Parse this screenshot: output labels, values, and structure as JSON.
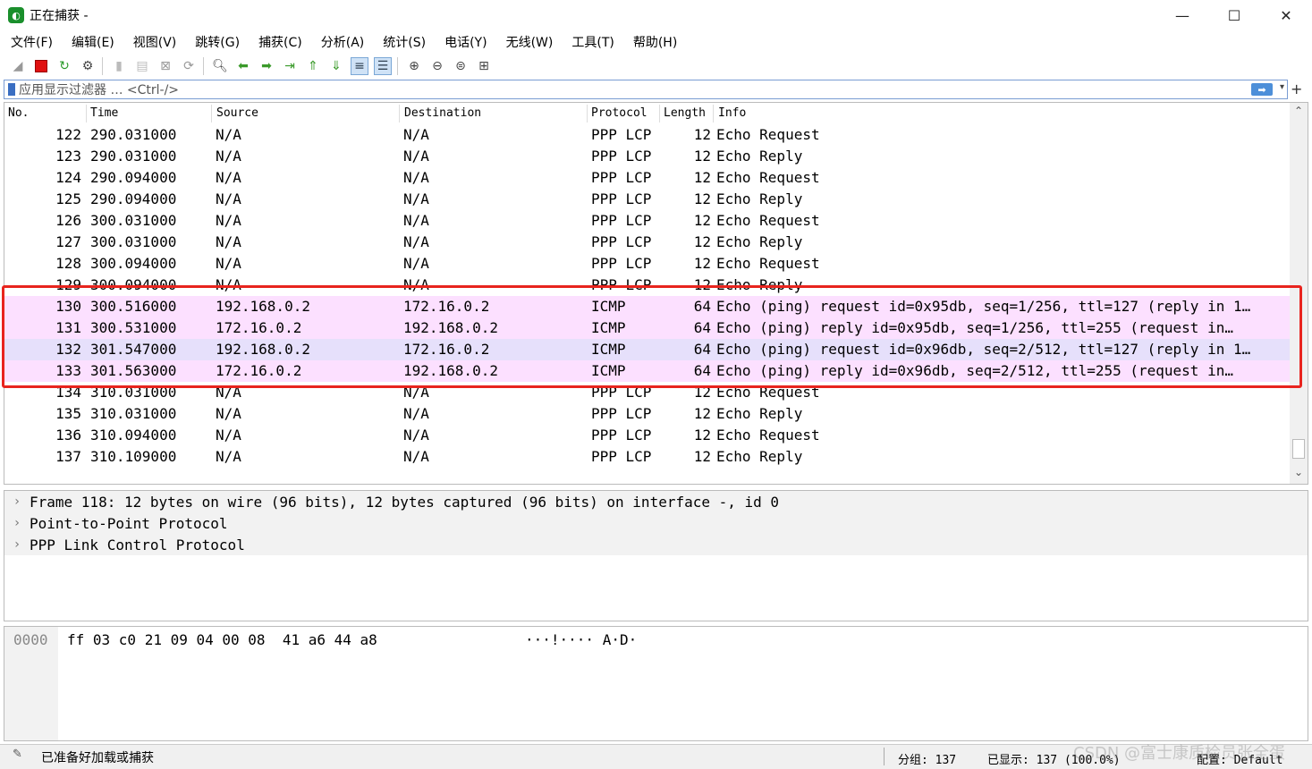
{
  "window": {
    "title": "正在捕获 -",
    "minimize": "—",
    "maximize": "☐",
    "close": "✕"
  },
  "menu": [
    "文件(F)",
    "编辑(E)",
    "视图(V)",
    "跳转(G)",
    "捕获(C)",
    "分析(A)",
    "统计(S)",
    "电话(Y)",
    "无线(W)",
    "工具(T)",
    "帮助(H)"
  ],
  "filter": {
    "placeholder": "应用显示过滤器 … <Ctrl-/>",
    "apply": "➡",
    "add": "+"
  },
  "columns": {
    "no": "No.",
    "time": "Time",
    "source": "Source",
    "destination": "Destination",
    "protocol": "Protocol",
    "length": "Length",
    "info": "Info"
  },
  "packets": [
    {
      "no": "122",
      "time": "290.031000",
      "src": "N/A",
      "dst": "N/A",
      "proto": "PPP LCP",
      "len": "12",
      "info": "Echo Request",
      "bg": "#ffffff"
    },
    {
      "no": "123",
      "time": "290.031000",
      "src": "N/A",
      "dst": "N/A",
      "proto": "PPP LCP",
      "len": "12",
      "info": "Echo Reply",
      "bg": "#ffffff"
    },
    {
      "no": "124",
      "time": "290.094000",
      "src": "N/A",
      "dst": "N/A",
      "proto": "PPP LCP",
      "len": "12",
      "info": "Echo Request",
      "bg": "#ffffff"
    },
    {
      "no": "125",
      "time": "290.094000",
      "src": "N/A",
      "dst": "N/A",
      "proto": "PPP LCP",
      "len": "12",
      "info": "Echo Reply",
      "bg": "#ffffff"
    },
    {
      "no": "126",
      "time": "300.031000",
      "src": "N/A",
      "dst": "N/A",
      "proto": "PPP LCP",
      "len": "12",
      "info": "Echo Request",
      "bg": "#ffffff"
    },
    {
      "no": "127",
      "time": "300.031000",
      "src": "N/A",
      "dst": "N/A",
      "proto": "PPP LCP",
      "len": "12",
      "info": "Echo Reply",
      "bg": "#ffffff"
    },
    {
      "no": "128",
      "time": "300.094000",
      "src": "N/A",
      "dst": "N/A",
      "proto": "PPP LCP",
      "len": "12",
      "info": "Echo Request",
      "bg": "#ffffff"
    },
    {
      "no": "129",
      "time": "300.094000",
      "src": "N/A",
      "dst": "N/A",
      "proto": "PPP LCP",
      "len": "12",
      "info": "Echo Reply",
      "bg": "#ffffff"
    },
    {
      "no": "130",
      "time": "300.516000",
      "src": "192.168.0.2",
      "dst": "172.16.0.2",
      "proto": "ICMP",
      "len": "64",
      "info": "Echo (ping) request  id=0x95db, seq=1/256, ttl=127 (reply in 1…",
      "bg": "#fce0ff"
    },
    {
      "no": "131",
      "time": "300.531000",
      "src": "172.16.0.2",
      "dst": "192.168.0.2",
      "proto": "ICMP",
      "len": "64",
      "info": "Echo (ping) reply    id=0x95db, seq=1/256, ttl=255 (request in…",
      "bg": "#fce0ff"
    },
    {
      "no": "132",
      "time": "301.547000",
      "src": "192.168.0.2",
      "dst": "172.16.0.2",
      "proto": "ICMP",
      "len": "64",
      "info": "Echo (ping) request  id=0x96db, seq=2/512, ttl=127 (reply in 1…",
      "bg": "#e6e0fb"
    },
    {
      "no": "133",
      "time": "301.563000",
      "src": "172.16.0.2",
      "dst": "192.168.0.2",
      "proto": "ICMP",
      "len": "64",
      "info": "Echo (ping) reply    id=0x96db, seq=2/512, ttl=255 (request in…",
      "bg": "#fce0ff"
    },
    {
      "no": "134",
      "time": "310.031000",
      "src": "N/A",
      "dst": "N/A",
      "proto": "PPP LCP",
      "len": "12",
      "info": "Echo Request",
      "bg": "#ffffff"
    },
    {
      "no": "135",
      "time": "310.031000",
      "src": "N/A",
      "dst": "N/A",
      "proto": "PPP LCP",
      "len": "12",
      "info": "Echo Reply",
      "bg": "#ffffff"
    },
    {
      "no": "136",
      "time": "310.094000",
      "src": "N/A",
      "dst": "N/A",
      "proto": "PPP LCP",
      "len": "12",
      "info": "Echo Request",
      "bg": "#ffffff"
    },
    {
      "no": "137",
      "time": "310.109000",
      "src": "N/A",
      "dst": "N/A",
      "proto": "PPP LCP",
      "len": "12",
      "info": "Echo Reply",
      "bg": "#ffffff"
    }
  ],
  "details": [
    "Frame 118: 12 bytes on wire (96 bits), 12 bytes captured (96 bits) on interface -, id 0",
    "Point-to-Point Protocol",
    "PPP Link Control Protocol"
  ],
  "bytes": {
    "offset": "0000",
    "hex": "ff 03 c0 21 09 04 00 08  41 a6 44 a8",
    "ascii": "···!···· A·D·"
  },
  "status": {
    "ready": "已准备好加载或捕获",
    "packets": "分组: 137",
    "displayed": "已显示: 137 (100.0%)",
    "profile": "配置: Default"
  },
  "watermark": "CSDN @富士康质检员张全蛋",
  "colors": {
    "highlight_border": "#e8241e",
    "icmp_row": "#fce0ff",
    "icmp_row_alt": "#e6e0fb"
  }
}
